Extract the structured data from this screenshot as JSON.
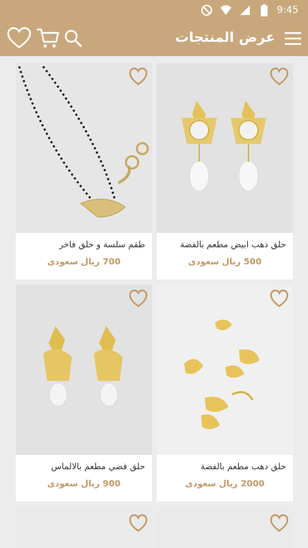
{
  "status_bar": {
    "time": "9:45"
  },
  "app_bar": {
    "title": "عرض المنتجات"
  },
  "colors": {
    "brand": "#c9a77c",
    "price": "#c29a69",
    "background": "#ececec"
  },
  "products": [
    {
      "name": "حلق دهب ابيض مطعم بالفضة",
      "price": "500 ريال سعودى"
    },
    {
      "name": "طقم سلسة و حلق فاخر",
      "price": "700 ريال سعودى"
    },
    {
      "name": "حلق دهب مطعم بالفضة",
      "price": "2000 ريال سعودى"
    },
    {
      "name": "حلق فضي مطعم بالالماس",
      "price": "900 ريال سعودى"
    }
  ]
}
